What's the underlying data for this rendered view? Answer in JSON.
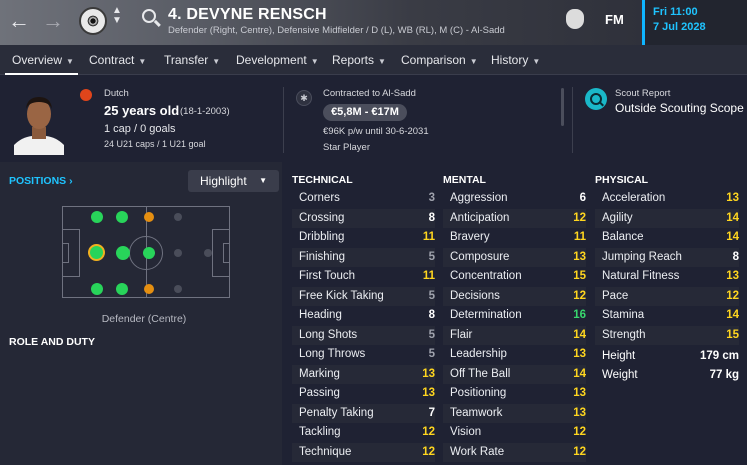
{
  "header": {
    "title": "4. DEVYNE RENSCH",
    "subtitle": "Defender (Right, Centre), Defensive Midfielder / D (L), WB (RL), M (C) - Al-Sadd",
    "brand": "FM",
    "date_line1": "Fri 11:00",
    "date_line2": "7 Jul 2028",
    "nav_back_icon": "arrow-left-icon",
    "nav_forward_icon": "arrow-right-icon"
  },
  "tabs": [
    {
      "label": "Overview"
    },
    {
      "label": "Contract"
    },
    {
      "label": "Transfer"
    },
    {
      "label": "Development"
    },
    {
      "label": "Reports"
    },
    {
      "label": "Comparison"
    },
    {
      "label": "History"
    }
  ],
  "profile": {
    "nationality": "Dutch",
    "age": "25 years old",
    "dob": "(18-1-2003)",
    "caps": "1 cap / 0 goals",
    "u21": "24 U21 caps / 1 U21 goal"
  },
  "contract": {
    "heading": "Contracted to Al-Sadd",
    "value": "€5,8M - €17M",
    "wage": "€96K p/w until 30-6-2031",
    "status": "Star Player"
  },
  "scout": {
    "heading": "Scout Report",
    "value": "Outside Scouting Scope"
  },
  "positions": {
    "heading": "POSITIONS",
    "highlight_label": "Highlight",
    "position_label": "Defender (Centre)",
    "role_heading": "ROLE AND DUTY"
  },
  "technical": {
    "heading": "TECHNICAL",
    "attrs": [
      {
        "name": "Corners",
        "value": "3"
      },
      {
        "name": "Crossing",
        "value": "8"
      },
      {
        "name": "Dribbling",
        "value": "11"
      },
      {
        "name": "Finishing",
        "value": "5"
      },
      {
        "name": "First Touch",
        "value": "11"
      },
      {
        "name": "Free Kick Taking",
        "value": "5"
      },
      {
        "name": "Heading",
        "value": "8"
      },
      {
        "name": "Long Shots",
        "value": "5"
      },
      {
        "name": "Long Throws",
        "value": "5"
      },
      {
        "name": "Marking",
        "value": "13"
      },
      {
        "name": "Passing",
        "value": "13"
      },
      {
        "name": "Penalty Taking",
        "value": "7"
      },
      {
        "name": "Tackling",
        "value": "12"
      },
      {
        "name": "Technique",
        "value": "12"
      }
    ]
  },
  "mental": {
    "heading": "MENTAL",
    "attrs": [
      {
        "name": "Aggression",
        "value": "6"
      },
      {
        "name": "Anticipation",
        "value": "12"
      },
      {
        "name": "Bravery",
        "value": "11"
      },
      {
        "name": "Composure",
        "value": "13"
      },
      {
        "name": "Concentration",
        "value": "15"
      },
      {
        "name": "Decisions",
        "value": "12"
      },
      {
        "name": "Determination",
        "value": "16"
      },
      {
        "name": "Flair",
        "value": "14"
      },
      {
        "name": "Leadership",
        "value": "13"
      },
      {
        "name": "Off The Ball",
        "value": "14"
      },
      {
        "name": "Positioning",
        "value": "13"
      },
      {
        "name": "Teamwork",
        "value": "13"
      },
      {
        "name": "Vision",
        "value": "12"
      },
      {
        "name": "Work Rate",
        "value": "12"
      }
    ]
  },
  "physical": {
    "heading": "PHYSICAL",
    "attrs": [
      {
        "name": "Acceleration",
        "value": "13"
      },
      {
        "name": "Agility",
        "value": "14"
      },
      {
        "name": "Balance",
        "value": "14"
      },
      {
        "name": "Jumping Reach",
        "value": "8"
      },
      {
        "name": "Natural Fitness",
        "value": "13"
      },
      {
        "name": "Pace",
        "value": "12"
      },
      {
        "name": "Stamina",
        "value": "14"
      },
      {
        "name": "Strength",
        "value": "15"
      }
    ],
    "height_label": "Height",
    "height_value": "179 cm",
    "weight_label": "Weight",
    "weight_value": "77 kg"
  },
  "colors": {
    "accent": "#1fc4ff",
    "attr_low": "#ffffff",
    "attr_mid": "#ffd61f",
    "attr_high": "#38d86e",
    "natural_position": "#28d45a",
    "accomplished_position": "#e58f11"
  }
}
